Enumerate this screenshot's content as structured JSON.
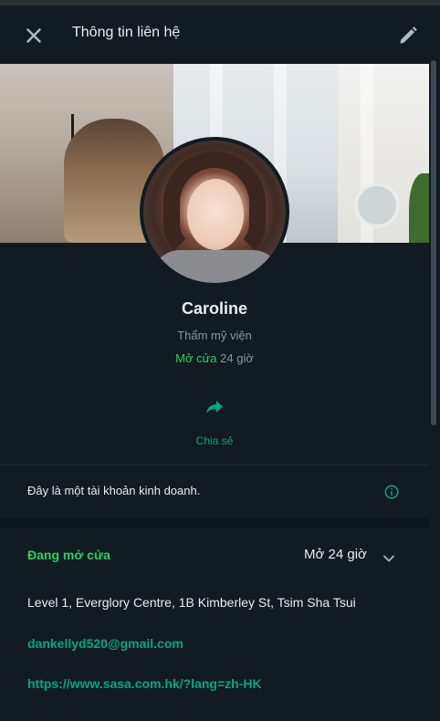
{
  "header": {
    "title": "Thông tin liên hệ",
    "close_icon": "close-icon",
    "edit_icon": "pencil-icon"
  },
  "profile": {
    "name": "Caroline",
    "category": "Thẩm mỹ viện",
    "status_open": "Mở cửa",
    "status_hours": "24 giờ"
  },
  "actions": {
    "share_label": "Chia sẻ",
    "share_icon": "share-arrow-icon"
  },
  "business_note": {
    "text": "Đây là một tài khoản kinh doanh.",
    "icon": "info-icon"
  },
  "details": {
    "open_status": "Đang mở cửa",
    "open_hours": "Mở 24 giờ",
    "expand_icon": "chevron-down-icon",
    "address": "Level 1, Everglory Centre, 1B Kimberley St, Tsim Sha Tsui",
    "email": "dankellyd520@gmail.com",
    "website": "https://www.sasa.com.hk/?lang=zh-HK"
  },
  "colors": {
    "background": "#111b21",
    "accent": "#00a884",
    "open_green": "#25d366",
    "muted_text": "#8696a0"
  }
}
